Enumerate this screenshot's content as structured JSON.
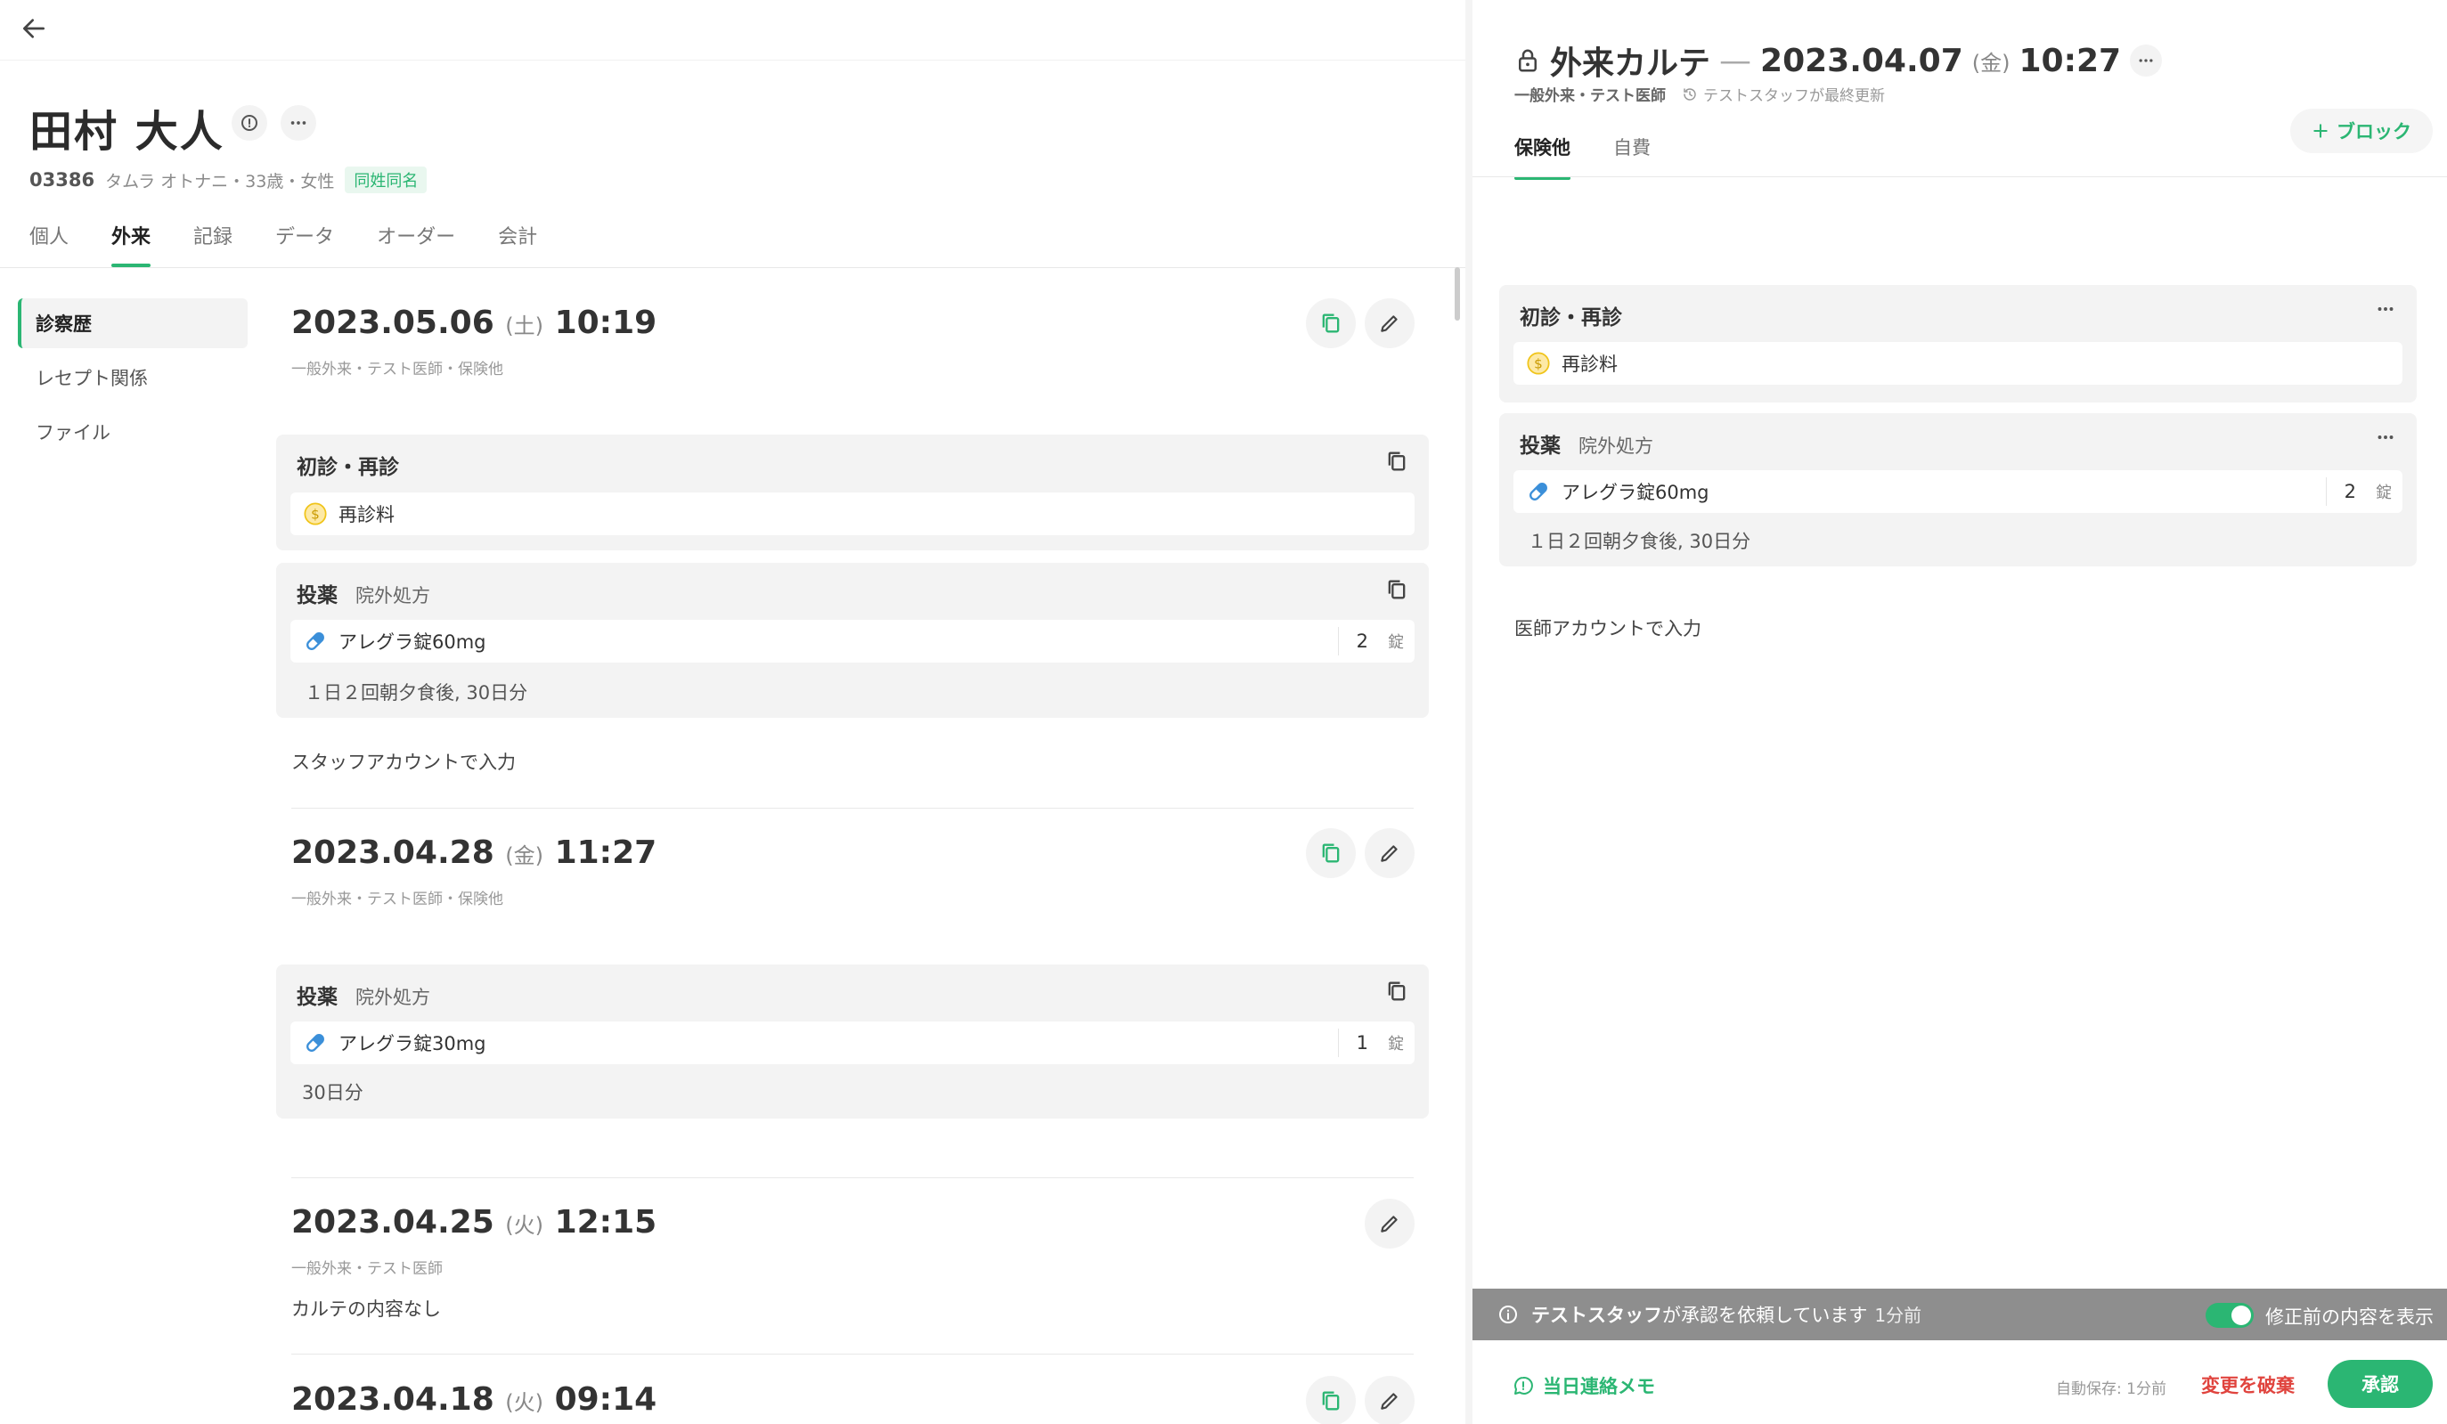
{
  "patient": {
    "name": "田村 大人",
    "id": "03386",
    "details": "タムラ オトナニ・33歳・女性",
    "badge": "同姓同名"
  },
  "tabs": [
    "個人",
    "外来",
    "記録",
    "データ",
    "オーダー",
    "会計"
  ],
  "active_tab": "外来",
  "sidenav": [
    "診察歴",
    "レセプト関係",
    "ファイル"
  ],
  "visits": [
    {
      "date": "2023.05.06",
      "dow": "(土)",
      "time": "10:19",
      "meta": "一般外来・テスト医師・保険他",
      "blocks": [
        {
          "title": "初診・再診",
          "sub": "",
          "rows": [
            {
              "name": "再診料"
            }
          ],
          "note": ""
        },
        {
          "title": "投薬",
          "sub": "院外処方",
          "rows": [
            {
              "name": "アレグラ錠60mg",
              "qty": "2",
              "unit": "錠"
            }
          ],
          "note": "１日２回朝夕食後, 30日分"
        }
      ],
      "footer_note": "スタッフアカウントで入力"
    },
    {
      "date": "2023.04.28",
      "dow": "(金)",
      "time": "11:27",
      "meta": "一般外来・テスト医師・保険他",
      "blocks": [
        {
          "title": "投薬",
          "sub": "院外処方",
          "rows": [
            {
              "name": "アレグラ錠30mg",
              "qty": "1",
              "unit": "錠"
            }
          ],
          "note": "30日分"
        }
      ]
    },
    {
      "date": "2023.04.25",
      "dow": "(火)",
      "time": "12:15",
      "meta": "一般外来・テスト医師",
      "empty_note": "カルテの内容なし"
    },
    {
      "date": "2023.04.18",
      "dow": "(火)",
      "time": "09:14"
    }
  ],
  "record": {
    "title": "外来カルテ",
    "dash": "—",
    "date": "2023.04.07",
    "dow": "(金)",
    "time": "10:27",
    "meta_main": "一般外来・テスト医師",
    "meta_updated": "テストスタッフが最終更新",
    "add_block_label": "ブロック",
    "tabs": [
      "保険他",
      "自費"
    ],
    "blocks": [
      {
        "title": "初診・再診",
        "sub": "",
        "rows": [
          {
            "name": "再診料"
          }
        ]
      },
      {
        "title": "投薬",
        "sub": "院外処方",
        "rows": [
          {
            "name": "アレグラ錠60mg",
            "qty": "2",
            "unit": "錠"
          }
        ],
        "note": "１日２回朝夕食後, 30日分"
      }
    ],
    "note": "医師アカウントで入力",
    "approval": {
      "requester": "テストスタッフ",
      "message": "が承認を依頼しています",
      "ago": "1分前",
      "toggle_label": "修正前の内容を表示"
    },
    "footer": {
      "memo": "当日連絡メモ",
      "autosave": "自動保存: 1分前",
      "discard": "変更を破棄",
      "approve": "承認"
    }
  },
  "colors": {
    "accent": "#2bb673",
    "danger": "#e0443e",
    "coin": "#f0c419",
    "pill": "#3b8fd9"
  }
}
